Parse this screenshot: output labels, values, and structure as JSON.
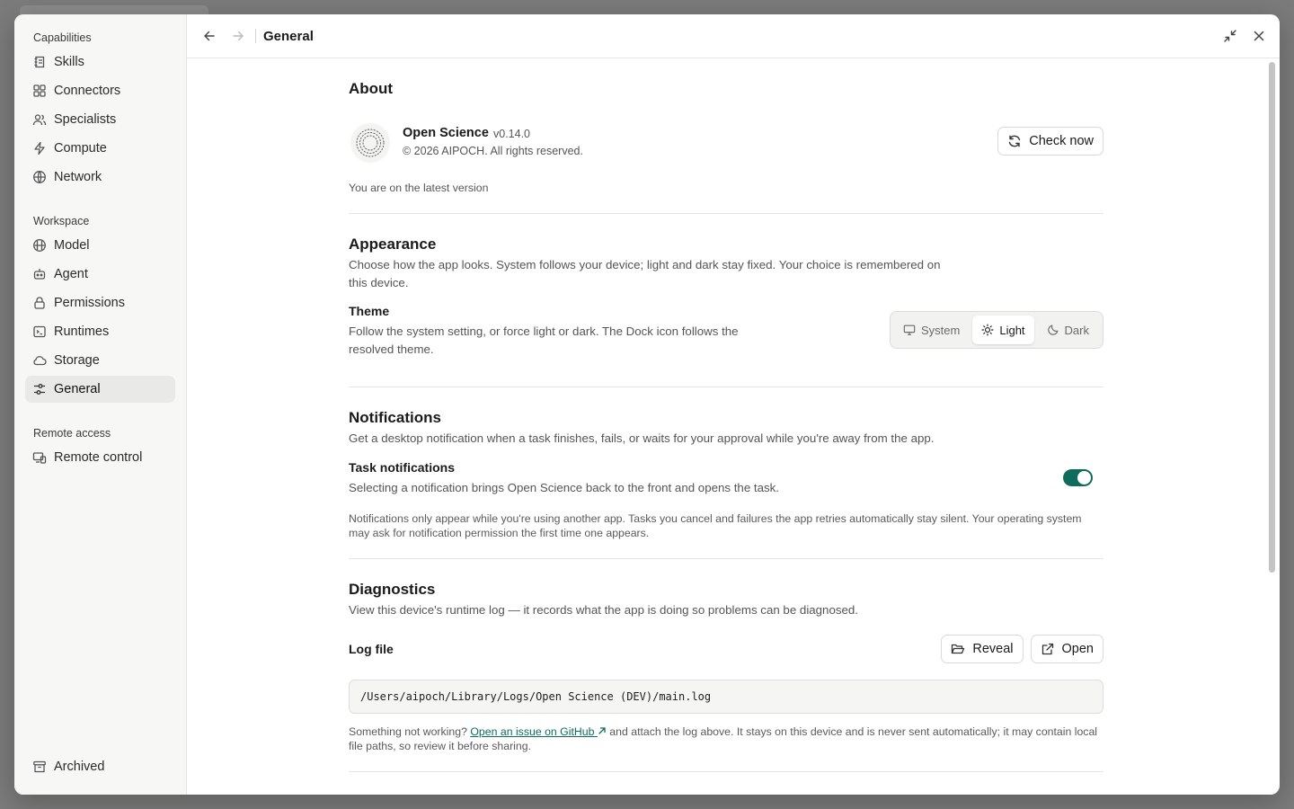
{
  "sidebar": {
    "groups": [
      {
        "title": "Capabilities",
        "items": [
          {
            "label": "Skills",
            "icon": "skills-icon"
          },
          {
            "label": "Connectors",
            "icon": "connectors-icon"
          },
          {
            "label": "Specialists",
            "icon": "specialists-icon"
          },
          {
            "label": "Compute",
            "icon": "lightning-icon"
          },
          {
            "label": "Network",
            "icon": "globe-icon"
          }
        ]
      },
      {
        "title": "Workspace",
        "items": [
          {
            "label": "Model",
            "icon": "model-icon"
          },
          {
            "label": "Agent",
            "icon": "robot-icon"
          },
          {
            "label": "Permissions",
            "icon": "lock-icon"
          },
          {
            "label": "Runtimes",
            "icon": "terminal-icon"
          },
          {
            "label": "Storage",
            "icon": "cloud-icon"
          },
          {
            "label": "General",
            "icon": "sliders-icon",
            "active": true
          }
        ]
      },
      {
        "title": "Remote access",
        "items": [
          {
            "label": "Remote control",
            "icon": "remote-icon"
          }
        ]
      }
    ],
    "bottom": {
      "label": "Archived",
      "icon": "archive-icon"
    }
  },
  "topbar": {
    "title": "General"
  },
  "about": {
    "title": "About",
    "app_name": "Open Science",
    "version": "v0.14.0",
    "copyright": "© 2026 AIPOCH. All rights reserved.",
    "check_label": "Check now",
    "status": "You are on the latest version"
  },
  "appearance": {
    "title": "Appearance",
    "description": "Choose how the app looks. System follows your device; light and dark stay fixed. Your choice is remembered on this device.",
    "theme_label": "Theme",
    "theme_description": "Follow the system setting, or force light or dark. The Dock icon follows the resolved theme.",
    "options": [
      "System",
      "Light",
      "Dark"
    ],
    "selected": "Light"
  },
  "notifications": {
    "title": "Notifications",
    "description": "Get a desktop notification when a task finishes, fails, or waits for your approval while you're away from the app.",
    "task_label": "Task notifications",
    "task_description": "Selecting a notification brings Open Science back to the front and opens the task.",
    "enabled": true,
    "note": "Notifications only appear while you're using another app. Tasks you cancel and failures the app retries automatically stay silent. Your operating system may ask for notification permission the first time one appears."
  },
  "diagnostics": {
    "title": "Diagnostics",
    "description": "View this device's runtime log — it records what the app is doing so problems can be diagnosed.",
    "log_label": "Log file",
    "reveal_label": "Reveal",
    "open_label": "Open",
    "log_path": "/Users/aipoch/Library/Logs/Open Science (DEV)/main.log",
    "help_prefix": "Something not working?",
    "help_link": "Open an issue on GitHub",
    "help_suffix": "and attach the log above. It stays on this device and is never sent automatically; it may contain local file paths, so review it before sharing."
  },
  "colors": {
    "accent": "#0f6b5c",
    "sidebar_bg": "#f7f7f6",
    "active_item_bg": "#e9e9e8"
  }
}
